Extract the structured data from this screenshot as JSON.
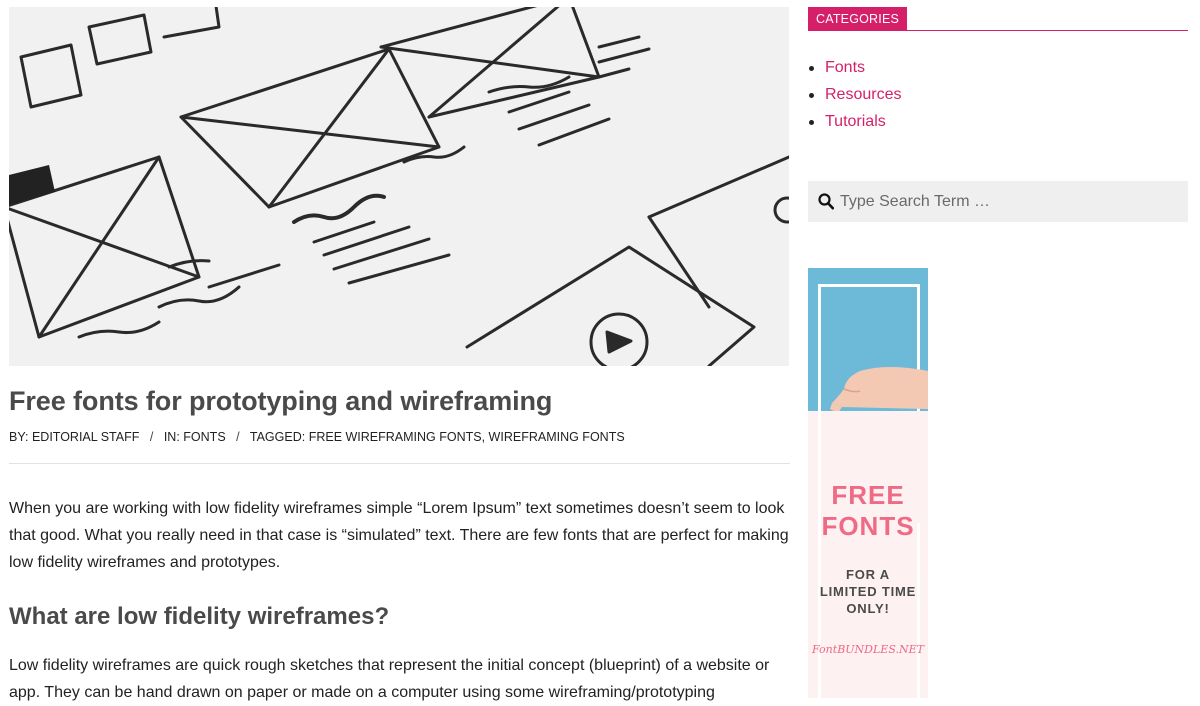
{
  "post": {
    "title": "Free fonts for prototyping and wireframing",
    "meta": {
      "by_label": "BY:",
      "author": "EDITORIAL STAFF",
      "in_label": "IN:",
      "category": "FONTS",
      "tagged_label": "TAGGED:",
      "tags": "FREE WIREFRAMING FONTS, WIREFRAMING FONTS",
      "separator": "/"
    },
    "intro": "When you are working with low fidelity wireframes simple “Lorem Ipsum” text sometimes doesn’t seem to look that good. What you really need in that case is “simulated” text. There are few fonts that are perfect for making low fidelity wireframes and prototypes.",
    "heading": "What are low fidelity wireframes?",
    "paragraph": "Low fidelity wireframes are quick rough sketches that represent the initial concept (blueprint) of a website or app. They can be hand drawn on paper or made on a computer using some wireframing/prototyping"
  },
  "sidebar": {
    "categories_title": "CATEGORIES",
    "categories": [
      {
        "label": "Fonts"
      },
      {
        "label": "Resources"
      },
      {
        "label": "Tutorials"
      }
    ],
    "search": {
      "placeholder": "Type Search Term …",
      "value": "",
      "icon": "search-icon"
    },
    "ad": {
      "headline_1": "FREE",
      "headline_2": "FONTS",
      "subline_1": "FOR A",
      "subline_2": "LIMITED TIME",
      "subline_3": "ONLY!",
      "brand": "FontBUNDLES.NET"
    }
  },
  "colors": {
    "accent": "#d61f69",
    "ad_pink": "#ef6a85",
    "ad_blue": "#6cbad8",
    "search_bg": "#efefef"
  }
}
